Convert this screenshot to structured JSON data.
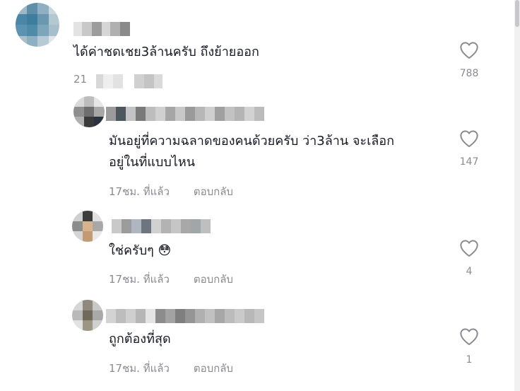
{
  "comments": [
    {
      "text": "ได้ค่าชดเชย3ล้านครับ ถึงย้ายออก",
      "time": "21",
      "reply": "",
      "likes": "788"
    },
    {
      "text_line1": "มันอยู่ที่ความฉลาดของคนด้วยครับ ว่า3ล้าน จะเลือก",
      "text_line2": "อยู่ในที่แบบไหน",
      "time": "17ชม. ที่แล้ว",
      "reply": "ตอบกลับ",
      "likes": "147"
    },
    {
      "text": "ใช่ครับๆ 😳",
      "time": "17ชม. ที่แล้ว",
      "reply": "ตอบกลับ",
      "likes": "4"
    },
    {
      "text": "ถูกต้องที่สุด",
      "time": "17ชม. ที่แล้ว",
      "reply": "ตอบกลับ",
      "likes": "1"
    }
  ],
  "icons": {
    "like": "heart-outline-icon"
  },
  "colors": {
    "text": "#161823",
    "meta": "#8a8b91"
  }
}
